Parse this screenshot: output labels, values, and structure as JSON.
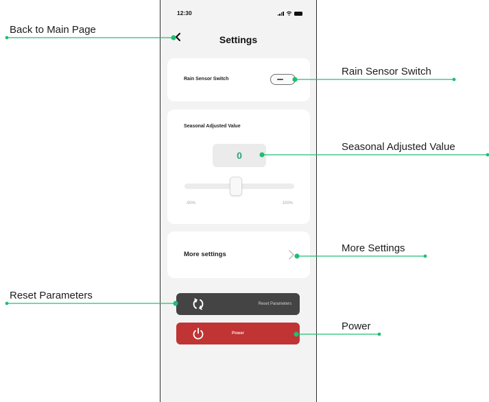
{
  "status_bar": {
    "time": "12:30"
  },
  "header": {
    "title": "Settings",
    "back_icon": "chevron-left-icon"
  },
  "rain_sensor": {
    "label": "Rain Sensor Switch",
    "toggle_on": false
  },
  "seasonal": {
    "label": "Seasonal Adjusted Value",
    "value": "0",
    "slider_min": "-90%",
    "slider_max": "100%",
    "slider_fraction": 0.47
  },
  "more_settings": {
    "label": "More settings",
    "icon": "chevron-right-icon"
  },
  "buttons": {
    "reset_label": "Reset Parameters",
    "reset_icon": "refresh-icon",
    "power_label": "Power",
    "power_icon": "power-icon"
  },
  "callouts": {
    "back": "Back to Main Page",
    "rain": "Rain Sensor Switch",
    "seasonal": "Seasonal Adjusted Value",
    "more": "More Settings",
    "reset": "Reset Parameters",
    "power": "Power"
  },
  "colors": {
    "accent_green": "#1dbf73",
    "value_green": "#2aa57a",
    "reset_button": "#444444",
    "power_button": "#c03434"
  }
}
